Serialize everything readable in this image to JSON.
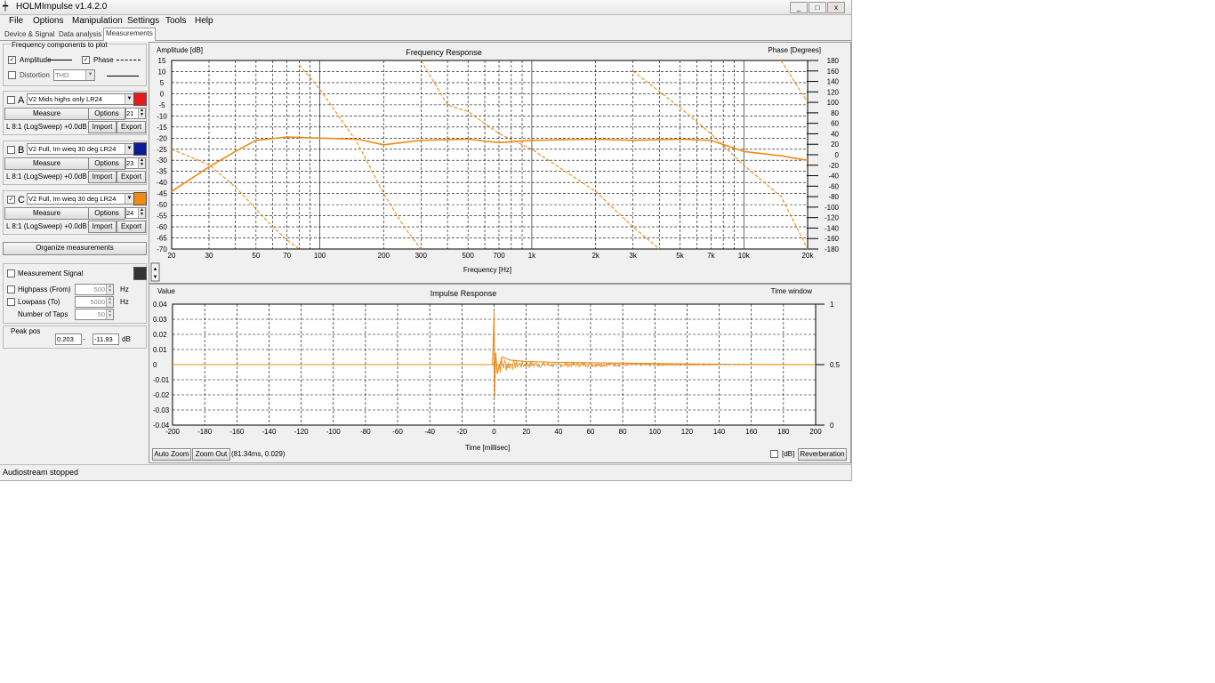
{
  "window": {
    "title": "HOLMImpulse v1.4.2.0",
    "min": "_",
    "max": "□",
    "close": "x"
  },
  "menu": [
    "File",
    "Options",
    "Manipulation",
    "Settings",
    "Tools",
    "Help"
  ],
  "tabs": [
    "Device & Signal",
    "Data analysis",
    "Measurements"
  ],
  "left": {
    "freq_group_label": "Frequency components to plot",
    "amplitude_label": "Amplitude",
    "phase_label": "Phase",
    "distortion_label": "Distortion",
    "distortion_value": "THD",
    "measurements": [
      {
        "letter": "A",
        "checked": false,
        "name": "V2 Mids highs only LR24",
        "number": "21",
        "color": "#e8191c",
        "info": "L 8:1 (LogSweep) +0.0dB"
      },
      {
        "letter": "B",
        "checked": false,
        "name": "V2 Full, Im wieq 30 deg LR24",
        "number": "23",
        "color": "#0b1a99",
        "info": "L 8:1 (LogSweep) +0.0dB"
      },
      {
        "letter": "C",
        "checked": true,
        "name": "V2 Full, Im wieq 30 deg LR24",
        "number": "24",
        "color": "#f08a12",
        "info": "L 8:1 (LogSweep) +0.0dB"
      }
    ],
    "measure_btn": "Measure",
    "options_btn": "Options",
    "import_btn": "Import",
    "export_btn": "Export",
    "organize_btn": "Organize measurements",
    "measurement_signal_label": "Measurement Signal",
    "highpass_label": "Highpass (From)",
    "highpass_value": "500",
    "lowpass_label": "Lowpass (To)",
    "lowpass_value": "5000",
    "taps_label": "Number of Taps",
    "taps_value": "50",
    "hz": "Hz",
    "peak_label": "Peak pos",
    "peak_time": "0.203",
    "peak_dash": "-",
    "peak_db": "-11.93",
    "peak_unit": "dB"
  },
  "freq_chart": {
    "title": "Frequency Response",
    "ylabel": "Amplitude [dB]",
    "y2label": "Phase [Degrees]",
    "xlabel": "Frequency [Hz]",
    "xticks": [
      "20",
      "30",
      "50",
      "70",
      "100",
      "200",
      "300",
      "500",
      "700",
      "1k",
      "2k",
      "3k",
      "5k",
      "7k",
      "10k",
      "20k"
    ],
    "yticks": [
      "15",
      "10",
      "5",
      "0",
      "-5",
      "-10",
      "-15",
      "-20",
      "-25",
      "-30",
      "-35",
      "-40",
      "-45",
      "-50",
      "-55",
      "-60",
      "-65",
      "-70"
    ],
    "y2ticks": [
      "180",
      "160",
      "140",
      "120",
      "100",
      "80",
      "60",
      "40",
      "20",
      "0",
      "-20",
      "-40",
      "-60",
      "-80",
      "-100",
      "-120",
      "-140",
      "-160",
      "-180"
    ]
  },
  "impulse_chart": {
    "title": "Impulse Response",
    "ylabel": "Value",
    "y2label": "Time window",
    "xlabel": "Time [millisec]",
    "xticks": [
      "-200",
      "-180",
      "-160",
      "-140",
      "-120",
      "-100",
      "-80",
      "-60",
      "-40",
      "-20",
      "0",
      "20",
      "40",
      "60",
      "80",
      "100",
      "120",
      "140",
      "160",
      "180",
      "200"
    ],
    "yticks": [
      "0.04",
      "0.03",
      "0.02",
      "0.01",
      "0",
      "-0.01",
      "-0.02",
      "-0.03",
      "-0.04"
    ],
    "y2ticks": [
      "1",
      "0.5",
      "0"
    ],
    "auto_zoom": "Auto Zoom",
    "zoom_out": "Zoom Out",
    "cursor": "(81.34ms, 0.029)",
    "db_label": "[dB]",
    "reverb_btn": "Reverberation"
  },
  "status": "Audiostream stopped",
  "colors": {
    "curve": "#f08a12",
    "grid": "#000000",
    "plotbg": "#ffffff"
  },
  "chart_data": [
    {
      "type": "line",
      "title": "Frequency Response",
      "xlabel": "Frequency [Hz]",
      "ylabel": "Amplitude [dB]",
      "y2label": "Phase [Degrees]",
      "xscale": "log",
      "xlim": [
        20,
        20000
      ],
      "ylim": [
        -70,
        15
      ],
      "y2lim": [
        -180,
        180
      ],
      "grid": true,
      "series": [
        {
          "axis": "amplitude",
          "style": "solid",
          "x": [
            20,
            30,
            40,
            50,
            70,
            100,
            150,
            200,
            300,
            500,
            700,
            1000,
            2000,
            3000,
            5000,
            7000,
            10000,
            15000,
            20000
          ],
          "y": [
            -44,
            -33,
            -26,
            -21,
            -19.5,
            -20,
            -20.5,
            -23,
            -21,
            -20.5,
            -22,
            -21,
            -20.5,
            -21,
            -20.5,
            -21,
            -26,
            -28,
            -30
          ]
        },
        {
          "axis": "amplitude",
          "style": "dashed",
          "x": [
            20,
            30,
            40,
            50,
            60,
            70,
            80
          ],
          "y": [
            -25,
            -32,
            -42,
            -52,
            -60,
            -66,
            -70
          ]
        },
        {
          "axis": "amplitude",
          "style": "dashed",
          "x": [
            80,
            100,
            150,
            200,
            250,
            300
          ],
          "y": [
            13,
            2,
            -22,
            -45,
            -60,
            -70
          ]
        },
        {
          "axis": "amplitude",
          "style": "dashed",
          "x": [
            300,
            400,
            500,
            700,
            1000,
            2000,
            3000,
            4000
          ],
          "y": [
            15,
            -5,
            -8,
            -18,
            -25,
            -44,
            -60,
            -70
          ]
        },
        {
          "axis": "phase",
          "style": "dashed",
          "x": [
            3000,
            5000,
            7000,
            10000,
            15000,
            20000
          ],
          "y": [
            160,
            90,
            40,
            -20,
            -80,
            -180
          ]
        },
        {
          "axis": "phase",
          "style": "dashed",
          "x": [
            15000,
            20000
          ],
          "y": [
            180,
            100
          ]
        }
      ]
    },
    {
      "type": "line",
      "title": "Impulse Response",
      "xlabel": "Time [millisec]",
      "ylabel": "Value",
      "y2label": "Time window",
      "xlim": [
        -200,
        200
      ],
      "ylim": [
        -0.04,
        0.04
      ],
      "y2lim": [
        0,
        1
      ],
      "grid": true,
      "series": [
        {
          "x": [
            -200,
            -1,
            0,
            0.3,
            1,
            2,
            5,
            10,
            20,
            40,
            80,
            120,
            150,
            200
          ],
          "y": [
            0,
            0,
            0.035,
            -0.022,
            0.008,
            -0.006,
            0.005,
            0.003,
            0.002,
            0.0015,
            0.001,
            0.0005,
            0.0002,
            0
          ]
        }
      ]
    }
  ]
}
